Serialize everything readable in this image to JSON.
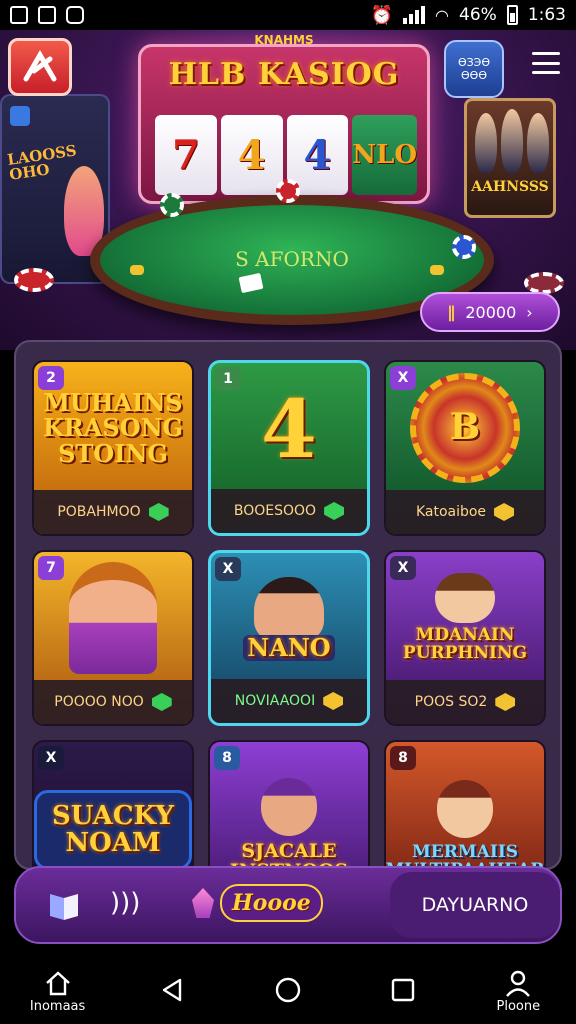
{
  "status_bar": {
    "battery": "46%",
    "time": "1:63"
  },
  "header": {
    "badge_label": "ӨЗЭӨ ӨӨӨ",
    "slot_top_label": "KNAHMS",
    "slot_title": "HLB KASIOG",
    "reels": [
      "7",
      "4",
      "4",
      "NLO"
    ],
    "table_label": "S AFORNO",
    "left_machine_title": "LAOOSS OHO",
    "right_screen_title": "AAHNSSS",
    "jackpot_value": "20000"
  },
  "games": [
    {
      "badge": "2",
      "title": "MUHAINS KRASONG STOING",
      "footer": "POBAHMOO",
      "gem_color": "#39d05a",
      "bg": "linear-gradient(#f7b21a,#b75b0c)"
    },
    {
      "badge": "1",
      "title": "4",
      "footer": "BOOESOOO",
      "gem_color": "#39d05a",
      "bg": "linear-gradient(#2e9a45,#125c26)"
    },
    {
      "badge": "X",
      "title": "B",
      "footer": "Katoaiboe",
      "gem_color": "#f2c230",
      "bg": "linear-gradient(#2c8a4a,#0e4e26)"
    },
    {
      "badge": "7",
      "title": "",
      "footer": "POOOO NOO",
      "gem_color": "#39d05a",
      "bg": "linear-gradient(#f4b52a,#a8540e)"
    },
    {
      "badge": "X",
      "title": "NANO",
      "footer": "NOVIAAOOI",
      "gem_color": "#f2c230",
      "bg": "linear-gradient(#2c8fb4,#133d5c)"
    },
    {
      "badge": "X",
      "title": "MDANAIN PURPHNING",
      "footer": "POOS SO2",
      "gem_color": "#f2c230",
      "bg": "linear-gradient(#8a3fc8,#3c1360)"
    },
    {
      "badge": "X",
      "title": "SUACKY NOAM",
      "footer": "",
      "gem_color": "",
      "bg": "linear-gradient(#2c1a4a,#160a26)"
    },
    {
      "badge": "8",
      "title": "SJACALE INSTNOOS",
      "footer": "",
      "gem_color": "",
      "bg": "linear-gradient(#8e3fd4,#3a1360)"
    },
    {
      "badge": "8",
      "title": "MERMAIIS MULTIPAAHEAR",
      "footer": "",
      "gem_color": "",
      "bg": "linear-gradient(#d4582a,#6a1a10)"
    }
  ],
  "bottom_bar": {
    "center_label": "Hoooe",
    "right_label": "DAYUARNO"
  },
  "nav": [
    {
      "label": "Inomaas"
    },
    {
      "label": ""
    },
    {
      "label": ""
    },
    {
      "label": ""
    },
    {
      "label": "Ploone"
    }
  ]
}
